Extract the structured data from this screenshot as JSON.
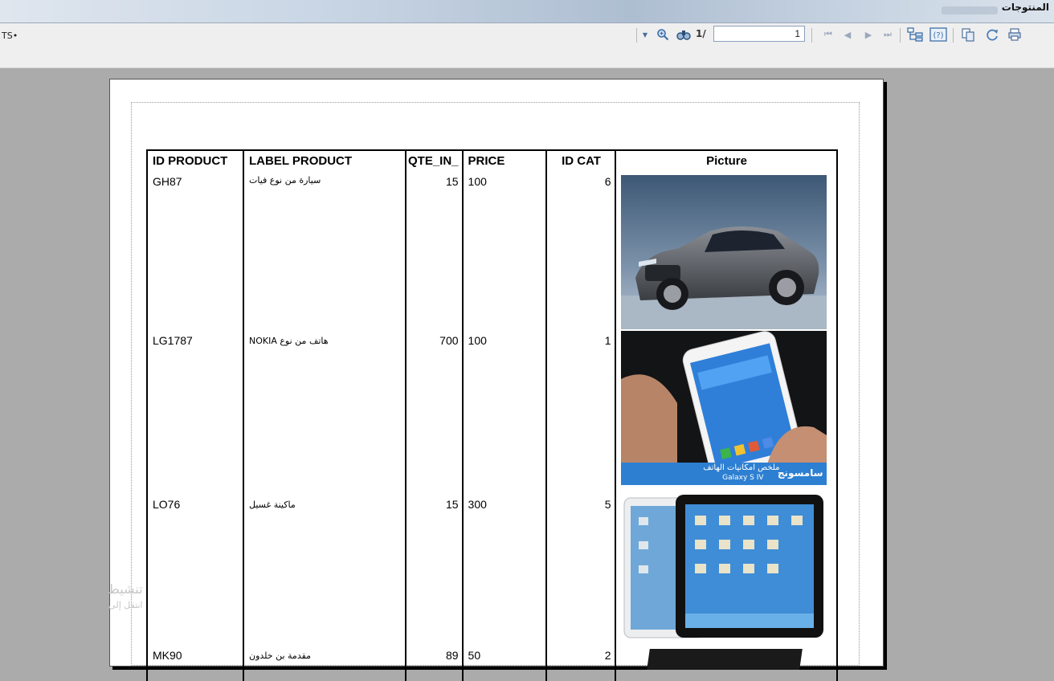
{
  "window": {
    "title": "المنتوجات"
  },
  "toolbar": {
    "left_label": "TS•",
    "current_page": "1",
    "page_total": "1/",
    "icons": [
      "zoom-dropdown-icon",
      "zoom-in-icon",
      "find-icon",
      "first-page-icon",
      "prev-page-icon",
      "next-page-icon",
      "last-page-icon",
      "group-tree-icon",
      "help-icon",
      "export-icon",
      "refresh-icon",
      "print-icon"
    ]
  },
  "report": {
    "columns": [
      "ID PRODUCT",
      "LABEL PRODUCT",
      "QTE_IN_",
      "PRICE",
      "ID CAT",
      "Picture"
    ],
    "rows": [
      {
        "id": "GH87",
        "label": "سيارة من نوع فيات",
        "qte": "15",
        "price": "100",
        "cat": "6",
        "picture": "car-photo"
      },
      {
        "id": "LG1787",
        "label": "هاتف من نوع NOKIA",
        "qte": "700",
        "price": "100",
        "cat": "1",
        "picture": "phone-photo",
        "caption_main": "ملخص امكانيات الهاتف",
        "caption_sub": "Galaxy S IV",
        "caption_side": "سامسونج"
      },
      {
        "id": "LO76",
        "label": "ماكينة غسيل",
        "qte": "15",
        "price": "300",
        "cat": "5",
        "picture": "tablet-photo"
      },
      {
        "id": "MK90",
        "label": "مقدمة بن خلدون",
        "qte": "89",
        "price": "50",
        "cat": "2",
        "picture": "book-photo"
      }
    ]
  },
  "watermark": {
    "line1": "تنشيط",
    "line2": "انتقل إلى"
  }
}
